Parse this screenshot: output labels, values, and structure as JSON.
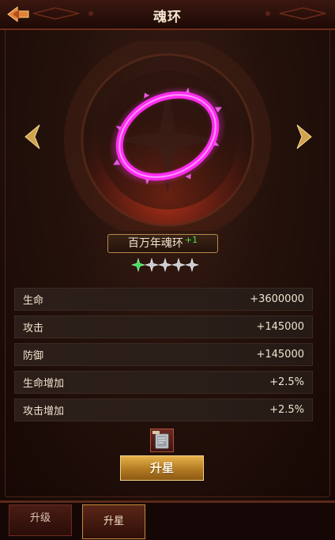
{
  "header": {
    "title": "魂环"
  },
  "soul_ring": {
    "name": "百万年魂环",
    "level_bonus": "+1",
    "stars_total": 5,
    "stars_lit": 1,
    "ring_color": "#ff2bf0"
  },
  "stats": [
    {
      "label": "生命",
      "value": "+3600000"
    },
    {
      "label": "攻击",
      "value": "+145000"
    },
    {
      "label": "防御",
      "value": "+145000"
    },
    {
      "label": "生命增加",
      "value": "+2.5%"
    },
    {
      "label": "攻击增加",
      "value": "+2.5%"
    }
  ],
  "upgrade_button": {
    "label": "升星"
  },
  "tabs": [
    {
      "label": "升级"
    },
    {
      "label": "升星"
    }
  ]
}
